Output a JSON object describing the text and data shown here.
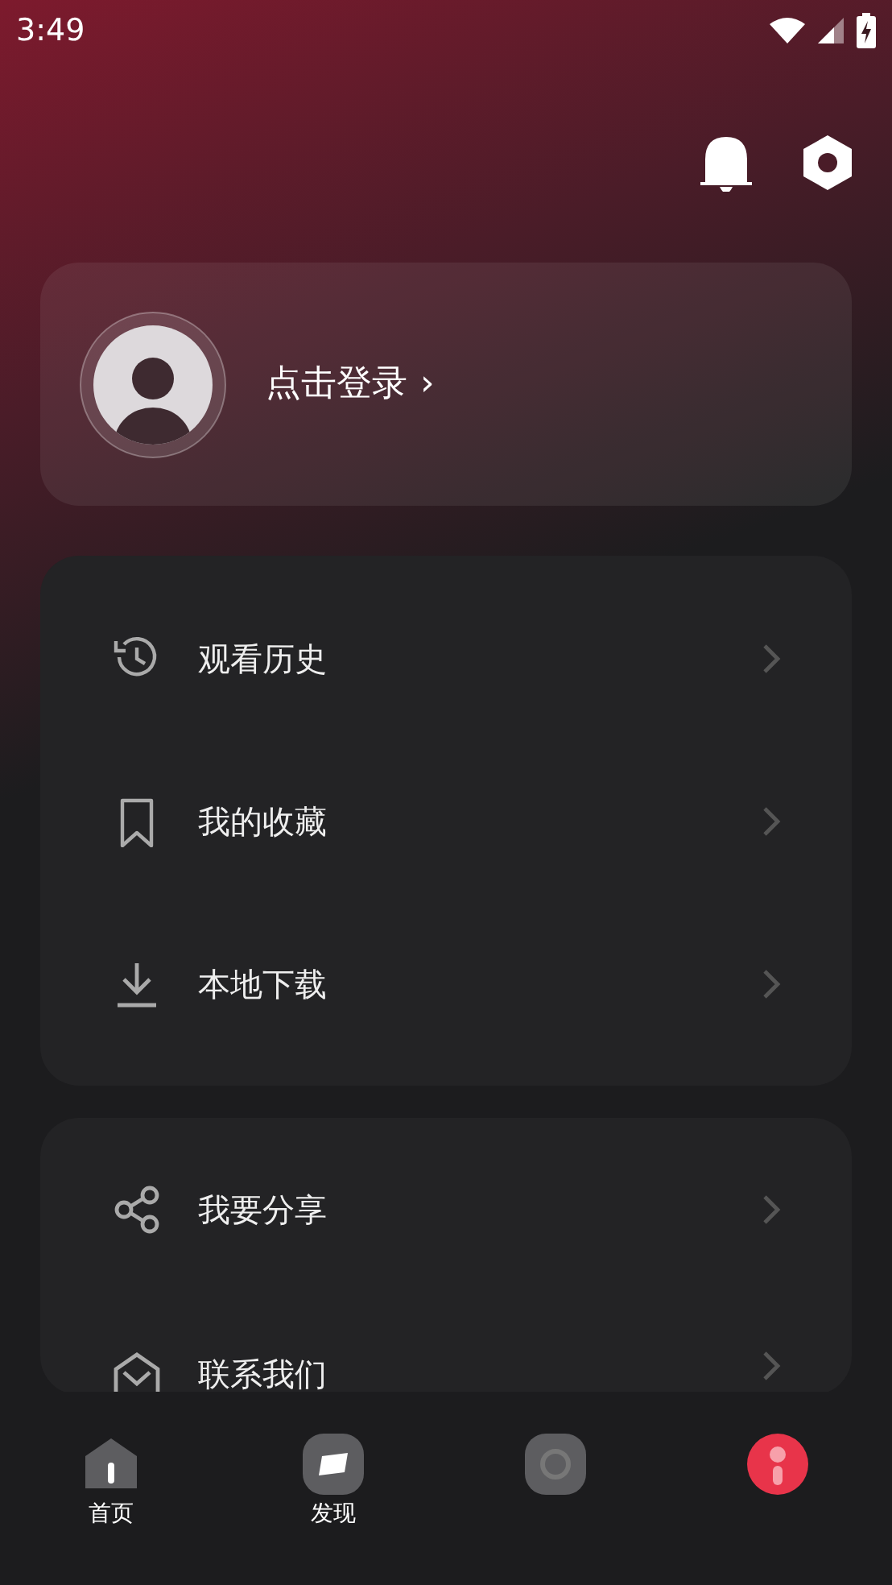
{
  "status_bar": {
    "time": "3:49"
  },
  "profile": {
    "login_text": "点击登录",
    "chevron": "›"
  },
  "menu_groups": [
    {
      "items": [
        {
          "kind": "history",
          "label": "观看历史"
        },
        {
          "kind": "bookmark",
          "label": "我的收藏"
        },
        {
          "kind": "download",
          "label": "本地下载"
        }
      ]
    },
    {
      "items": [
        {
          "kind": "share",
          "label": "我要分享"
        },
        {
          "kind": "contact",
          "label": "联系我们"
        }
      ]
    }
  ],
  "bottom_nav": [
    {
      "kind": "home",
      "label": "首页",
      "selected": false
    },
    {
      "kind": "discover",
      "label": "发现",
      "selected": false
    },
    {
      "kind": "planet",
      "selected": false
    },
    {
      "kind": "me",
      "selected": true
    }
  ]
}
